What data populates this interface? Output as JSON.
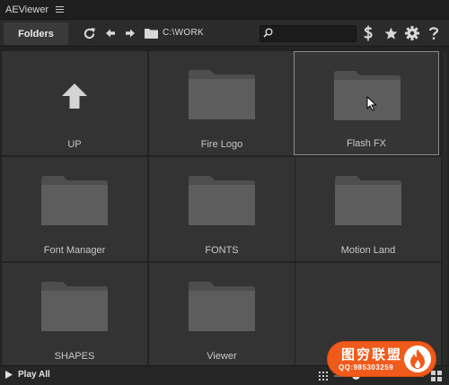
{
  "app": {
    "title": "AEViewer"
  },
  "toolbar": {
    "tab_label": "Folders",
    "path": "C:\\WORK",
    "search": {
      "value": "",
      "placeholder": ""
    },
    "icons": [
      "refresh-icon",
      "back-arrow-icon",
      "forward-arrow-icon",
      "folder-icon",
      "search-icon",
      "dollar-icon",
      "star-icon",
      "gear-icon",
      "help-icon"
    ]
  },
  "grid": {
    "items": [
      {
        "label": "UP",
        "icon": "up-arrow-icon"
      },
      {
        "label": "Fire Logo",
        "icon": "folder-icon"
      },
      {
        "label": "Flash FX",
        "icon": "folder-icon",
        "selected": true
      },
      {
        "label": "Font Manager",
        "icon": "folder-icon"
      },
      {
        "label": "FONTS",
        "icon": "folder-icon"
      },
      {
        "label": "Motion Land",
        "icon": "folder-icon"
      },
      {
        "label": "SHAPES",
        "icon": "folder-icon"
      },
      {
        "label": "Viewer",
        "icon": "folder-icon"
      }
    ]
  },
  "bottom": {
    "play_all": "Play All"
  },
  "watermark": {
    "line1": "图穷联盟",
    "line2": "QQ:985303259"
  },
  "colors": {
    "background": "#232323",
    "tile": "#333333",
    "folder": "#555555",
    "badge": "#f05a1a"
  }
}
